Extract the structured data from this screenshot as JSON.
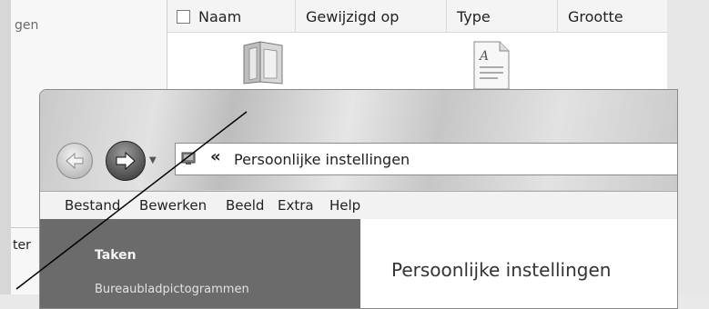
{
  "background_window": {
    "nav_partial_top": "gen",
    "nav_partial_bottom": "ter",
    "columns": [
      "Naam",
      "Gewijzigd op",
      "Type",
      "Grootte"
    ]
  },
  "foreground_window": {
    "address_chevron": "«",
    "address_path": "Persoonlijke instellingen",
    "menu": [
      "Bestand",
      "Bewerken",
      "Beeld",
      "Extra",
      "Help"
    ],
    "sidebar": {
      "title": "Taken",
      "link": "Bureaubladpictogrammen"
    },
    "content_heading": "Persoonlijke instellingen",
    "icons": {
      "back": "back-arrow-icon",
      "forward": "forward-arrow-icon",
      "recent": "dropdown-arrow-icon",
      "address": "control-panel-icon"
    }
  },
  "colors": {
    "sidebar": "#6b6b6b",
    "window_chrome": "#d3d3d3"
  }
}
